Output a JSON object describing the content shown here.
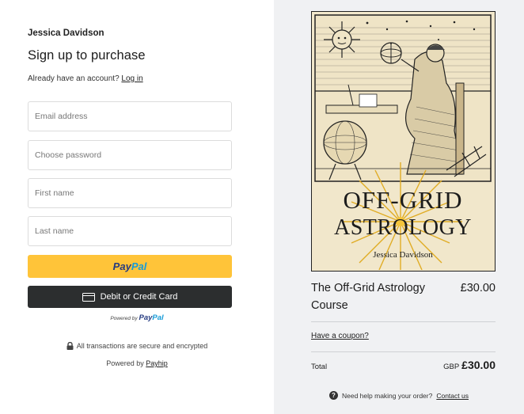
{
  "seller": {
    "name": "Jessica Davidson"
  },
  "form": {
    "heading": "Sign up to purchase",
    "account_prompt": "Already have an account?",
    "login_link": "Log in",
    "email_placeholder": "Email address",
    "password_placeholder": "Choose password",
    "first_name_placeholder": "First name",
    "last_name_placeholder": "Last name"
  },
  "payment": {
    "paypal_pay": "Pay",
    "paypal_pal": "Pal",
    "card_label": "Debit or Credit Card",
    "powered_by_text": "Powered by",
    "powered_by_pay": "Pay",
    "powered_by_pal": "Pal"
  },
  "footer": {
    "secure_text": "All transactions are secure and encrypted",
    "powered_by": "Powered by",
    "payhip_link": "Payhip"
  },
  "product": {
    "cover_title_line1": "OFF-GRID",
    "cover_title_line2": "ASTROLOGY",
    "cover_author": "Jessica Davidson",
    "title": "The Off-Grid Astrology Course",
    "price": "£30.00",
    "coupon_link": "Have a coupon?",
    "total_label": "Total",
    "total_currency": "GBP",
    "total_amount": "£30.00"
  },
  "help": {
    "text": "Need help making your order?",
    "contact_link": "Contact us"
  },
  "colors": {
    "paypal_yellow": "#ffc439",
    "paypal_dark_blue": "#253b80",
    "paypal_light_blue": "#179bd7",
    "card_button": "#2c2e2f",
    "summary_background": "#f0f1f3",
    "cover_paper": "#f1e7cb"
  },
  "icons": [
    "lock-icon",
    "card-icon",
    "help-icon",
    "sun-icon"
  ]
}
